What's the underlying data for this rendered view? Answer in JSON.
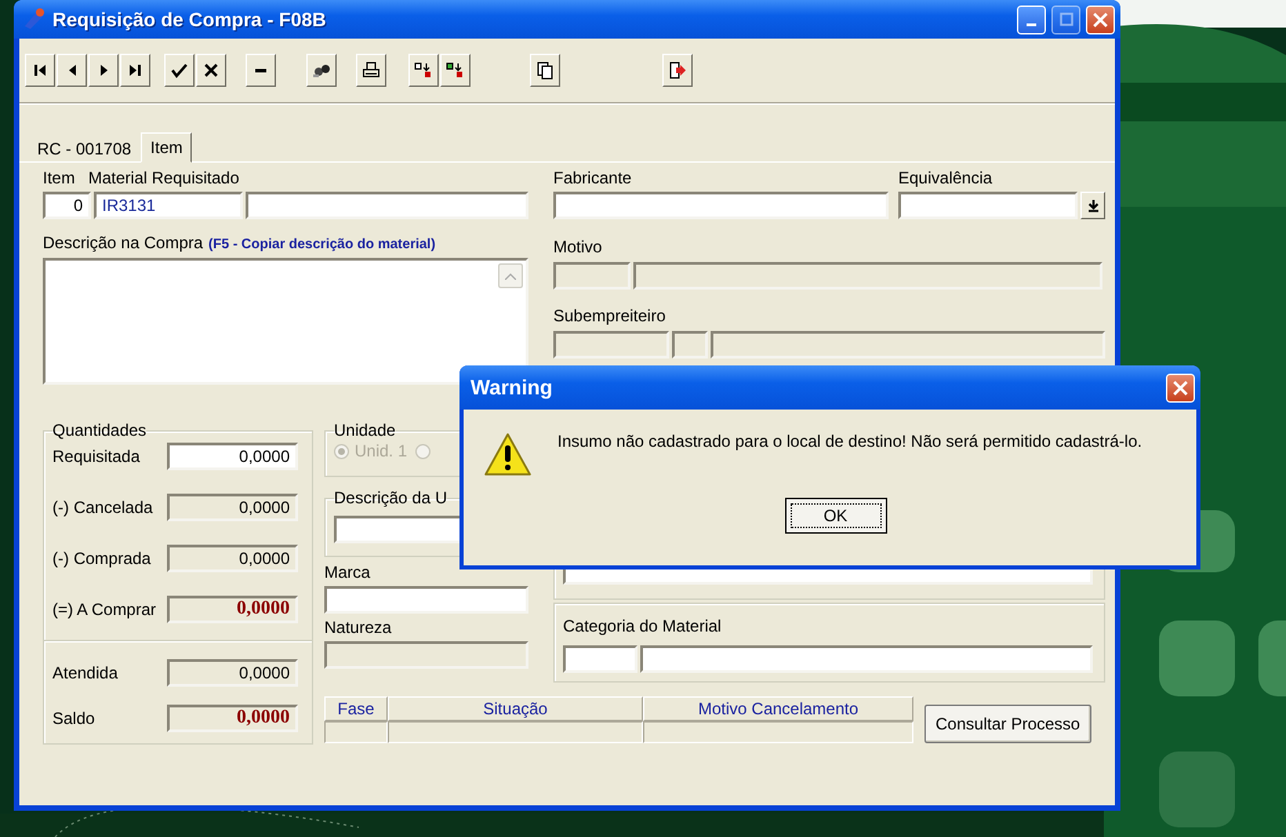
{
  "window": {
    "title": "Requisição de Compra - F08B"
  },
  "tabs": [
    {
      "label": "RC - 001708",
      "selected": false
    },
    {
      "label": "Item",
      "selected": true
    }
  ],
  "item": {
    "label": "Item",
    "value": "0"
  },
  "material": {
    "label": "Material Requisitado",
    "code": "IR3131"
  },
  "fabricante": {
    "label": "Fabricante"
  },
  "equivalencia": {
    "label": "Equivalência"
  },
  "descricao": {
    "label": "Descrição na Compra",
    "hint": "(F5 - Copiar descrição do material)"
  },
  "motivo": {
    "label": "Motivo"
  },
  "subempreiteiro": {
    "label": "Subempreiteiro"
  },
  "quantidades": {
    "title": "Quantidades",
    "rows": [
      {
        "label": "Requisitada",
        "value": "0,0000",
        "editable": true,
        "highlight": false
      },
      {
        "label": "(-) Cancelada",
        "value": "0,0000",
        "editable": false,
        "highlight": false
      },
      {
        "label": "(-) Comprada",
        "value": "0,0000",
        "editable": false,
        "highlight": false
      },
      {
        "label": "(=) A Comprar",
        "value": "0,0000",
        "editable": false,
        "highlight": true
      }
    ],
    "totals": [
      {
        "label": "Atendida",
        "value": "0,0000",
        "editable": false,
        "highlight": false
      },
      {
        "label": "Saldo",
        "value": "0,0000",
        "editable": false,
        "highlight": true
      }
    ]
  },
  "unidade": {
    "title": "Unidade",
    "options": [
      {
        "label": "Unid. 1",
        "selected": true
      },
      {
        "selected": false
      }
    ]
  },
  "descricao_unidade": {
    "title": "Descrição da U"
  },
  "marca": {
    "label": "Marca"
  },
  "natureza": {
    "label": "Natureza"
  },
  "categoria": {
    "label": "Categoria do Material"
  },
  "status_table": {
    "columns": [
      "Fase",
      "Situação",
      "Motivo Cancelamento"
    ]
  },
  "consultar_button": {
    "label": "Consultar Processo"
  },
  "dialog": {
    "title": "Warning",
    "message": "Insumo não cadastrado para o local de destino! Não será permitido cadastrá-lo.",
    "button": "OK"
  }
}
